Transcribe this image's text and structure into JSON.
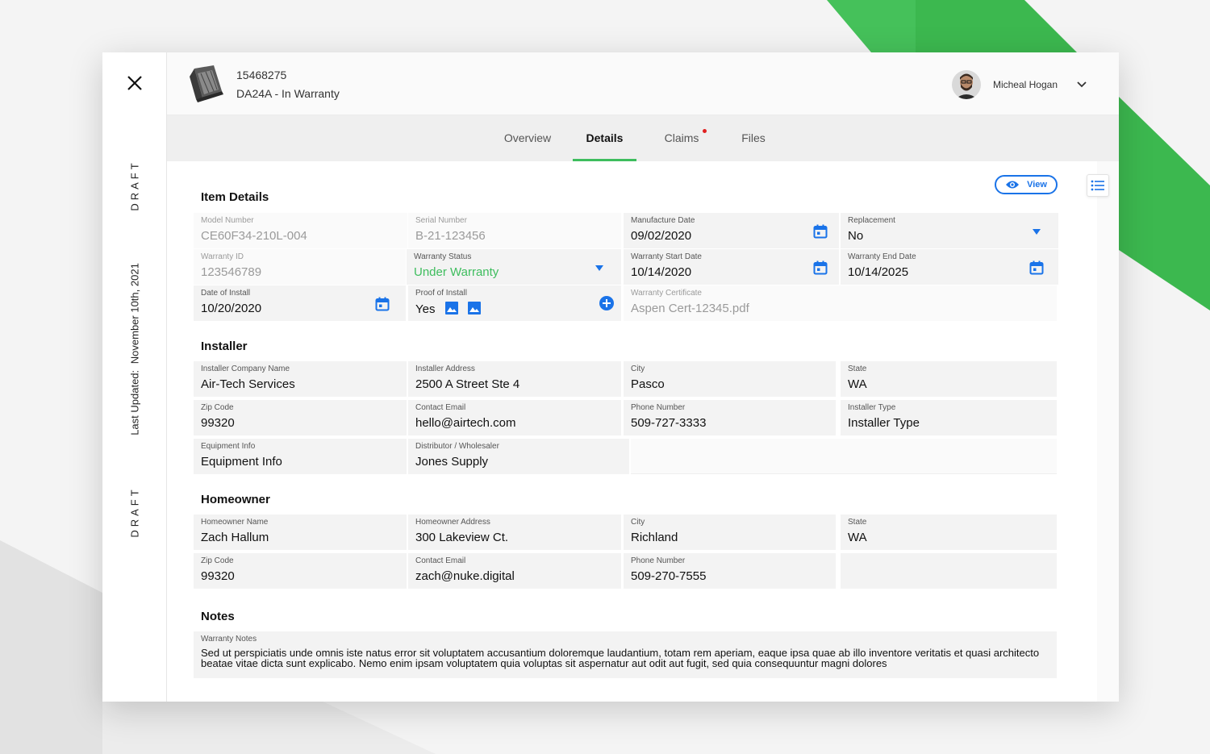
{
  "item": {
    "id": "15468275",
    "model_status": "DA24A - In Warranty"
  },
  "user": {
    "name": "Micheal Hogan"
  },
  "rail": {
    "draft_top": "DRAFT",
    "last_updated": "Last Updated:",
    "updated_date": "November 10th, 2021",
    "draft_bottom": "DRAFT"
  },
  "tabs": [
    {
      "label": "Overview",
      "active": false
    },
    {
      "label": "Details",
      "active": true
    },
    {
      "label": "Claims",
      "active": false,
      "notification": true
    },
    {
      "label": "Files",
      "active": false
    }
  ],
  "view_button": "View",
  "colors": {
    "accent_green": "#3ebd5e",
    "primary_blue": "#1a73e8",
    "notification_red": "#e02020"
  },
  "sections": {
    "item_details": {
      "title": "Item Details",
      "model_number": {
        "label": "Model Number",
        "value": "CE60F34-210L-004"
      },
      "serial_number": {
        "label": "Serial Number",
        "value": "B-21-123456"
      },
      "manufacture_date": {
        "label": "Manufacture Date",
        "value": "09/02/2020"
      },
      "replacement": {
        "label": "Replacement",
        "value": "No"
      },
      "warranty_id": {
        "label": "Warranty ID",
        "value": "123546789"
      },
      "warranty_status": {
        "label": "Warranty Status",
        "value": "Under Warranty"
      },
      "warranty_start": {
        "label": "Warranty Start Date",
        "value": "10/14/2020"
      },
      "warranty_end": {
        "label": "Warranty End Date",
        "value": "10/14/2025"
      },
      "install_date": {
        "label": "Date of Install",
        "value": "10/20/2020"
      },
      "proof_of_install": {
        "label": "Proof of Install",
        "value": "Yes"
      },
      "warranty_certificate": {
        "label": "Warranty Certificate",
        "value": "Aspen Cert-12345.pdf"
      }
    },
    "installer": {
      "title": "Installer",
      "company": {
        "label": "Installer Company Name",
        "value": "Air-Tech Services"
      },
      "address": {
        "label": "Installer Address",
        "value": "2500 A Street Ste 4"
      },
      "city": {
        "label": "City",
        "value": "Pasco"
      },
      "state": {
        "label": "State",
        "value": "WA"
      },
      "zip": {
        "label": "Zip Code",
        "value": "99320"
      },
      "email": {
        "label": "Contact Email",
        "value": "hello@airtech.com"
      },
      "phone": {
        "label": "Phone Number",
        "value": "509-727-3333"
      },
      "type": {
        "label": "Installer Type",
        "value": "Installer Type"
      },
      "equipment": {
        "label": "Equipment Info",
        "value": "Equipment Info"
      },
      "distributor": {
        "label": "Distributor / Wholesaler",
        "value": "Jones Supply"
      }
    },
    "homeowner": {
      "title": "Homeowner",
      "name": {
        "label": "Homeowner Name",
        "value": "Zach Hallum"
      },
      "address": {
        "label": "Homeowner Address",
        "value": "300 Lakeview Ct."
      },
      "city": {
        "label": "City",
        "value": "Richland"
      },
      "state": {
        "label": "State",
        "value": "WA"
      },
      "zip": {
        "label": "Zip Code",
        "value": "99320"
      },
      "email": {
        "label": "Contact Email",
        "value": "zach@nuke.digital"
      },
      "phone": {
        "label": "Phone Number",
        "value": "509-270-7555"
      }
    },
    "notes": {
      "title": "Notes",
      "warranty_notes": {
        "label": "Warranty Notes",
        "value": "Sed ut perspiciatis unde omnis iste natus error sit voluptatem accusantium doloremque laudantium, totam rem aperiam, eaque ipsa quae ab illo inventore veritatis et quasi architecto beatae vitae dicta sunt explicabo. Nemo enim ipsam voluptatem quia voluptas sit aspernatur aut odit aut fugit, sed quia consequuntur magni dolores"
      }
    }
  }
}
